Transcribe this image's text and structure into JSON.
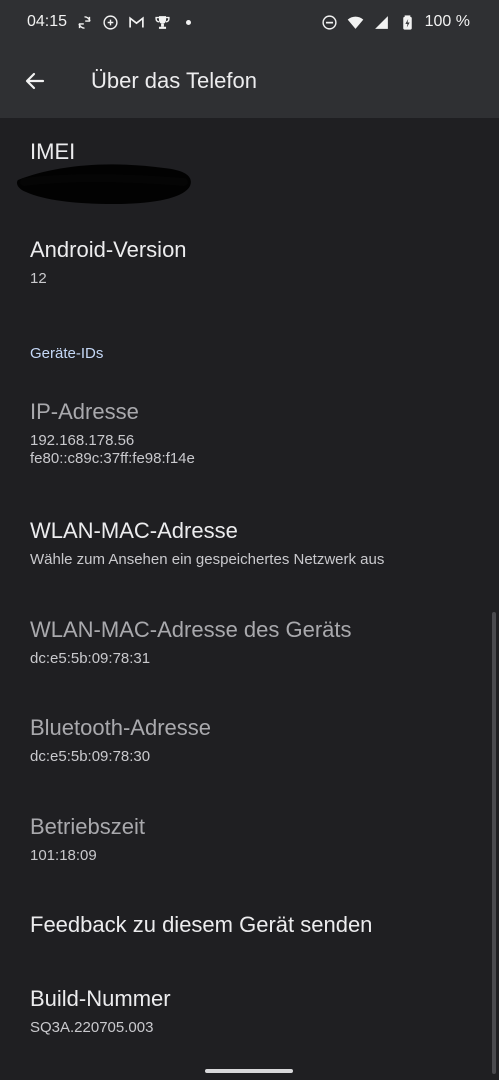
{
  "status_bar": {
    "time": "04:15",
    "battery": "100 %",
    "icons": [
      "sync-icon",
      "vpn-icon",
      "gmail-icon",
      "trophy-icon",
      "dot-icon",
      "dnd-icon",
      "wifi-icon",
      "signal-icon",
      "battery-icon"
    ]
  },
  "app_bar": {
    "title": "Über das Telefon",
    "back_icon": "arrow-back-icon"
  },
  "items": {
    "imei": {
      "title": "IMEI"
    },
    "android": {
      "title": "Android-Version",
      "summary": "12"
    },
    "section": {
      "title": "Geräte-IDs"
    },
    "ip": {
      "title": "IP-Adresse",
      "line1": "192.168.178.56",
      "line2": "fe80::c89c:37ff:fe98:f14e"
    },
    "wlan_mac": {
      "title": "WLAN-MAC-Adresse",
      "summary": "Wähle zum Ansehen ein gespeichertes Netzwerk aus"
    },
    "device_mac": {
      "title": "WLAN-MAC-Adresse des Geräts",
      "summary": "dc:e5:5b:09:78:31"
    },
    "bluetooth": {
      "title": "Bluetooth-Adresse",
      "summary": "dc:e5:5b:09:78:30"
    },
    "uptime": {
      "title": "Betriebszeit",
      "summary": "101:18:09"
    },
    "feedback": {
      "title": "Feedback zu diesem Gerät senden"
    },
    "build": {
      "title": "Build-Nummer",
      "summary": "SQ3A.220705.003"
    }
  },
  "colors": {
    "background": "#1f1f22",
    "app_bar": "#2f3033",
    "accent_header": "#c5d8f7",
    "dim_text": "#a9a9ad"
  }
}
